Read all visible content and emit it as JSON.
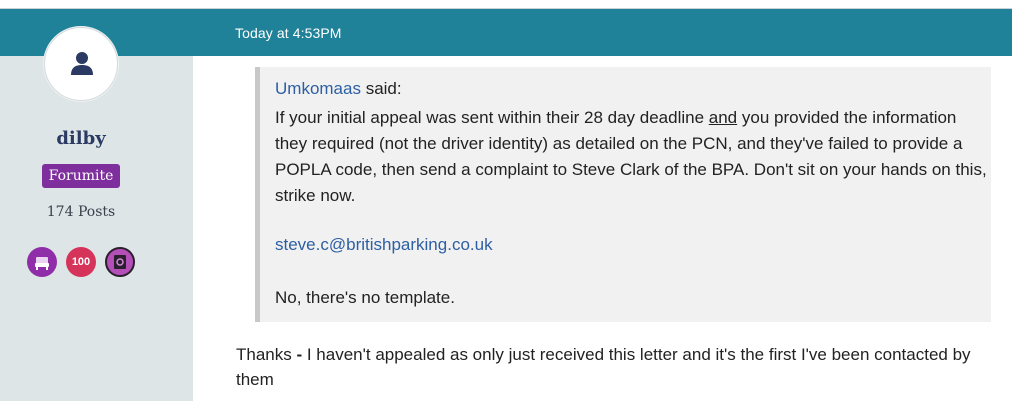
{
  "post": {
    "timestamp": "Today at 4:53PM"
  },
  "user": {
    "avatar_icon": "user-silhouette-icon",
    "username": "dilby",
    "rank": "Forumite",
    "posts": "174 Posts",
    "awards": [
      {
        "icon": "chair-award-icon",
        "color": "#8f2ea8"
      },
      {
        "icon": "100-award-icon",
        "label": "100",
        "color": "#d6335a"
      },
      {
        "icon": "book-award-icon",
        "color": "#b44fb8"
      }
    ]
  },
  "quote": {
    "author": "Umkomaas",
    "said": " said:",
    "body_part1": "If your initial appeal was sent within their 28 day deadline ",
    "body_underlined": "and",
    "body_part2": " you provided the information they required (not the driver identity) as detailed on the PCN, and they've failed to provide a POPLA code, then send a complaint to Steve Clark of the BPA. Don't sit on your hands on this, strike now.",
    "email": "steve.c@britishparking.co.uk",
    "closing": "No, there's no template."
  },
  "reply": {
    "lead": "Thanks",
    "dash": " - ",
    "text": "I haven't appealed as only just received this letter and it's the first I've been contacted by them"
  },
  "colors": {
    "header": "#1f8299",
    "sidebar": "#dde5e7",
    "rank_badge": "#7e2f9d",
    "link": "#2d5fa3"
  }
}
